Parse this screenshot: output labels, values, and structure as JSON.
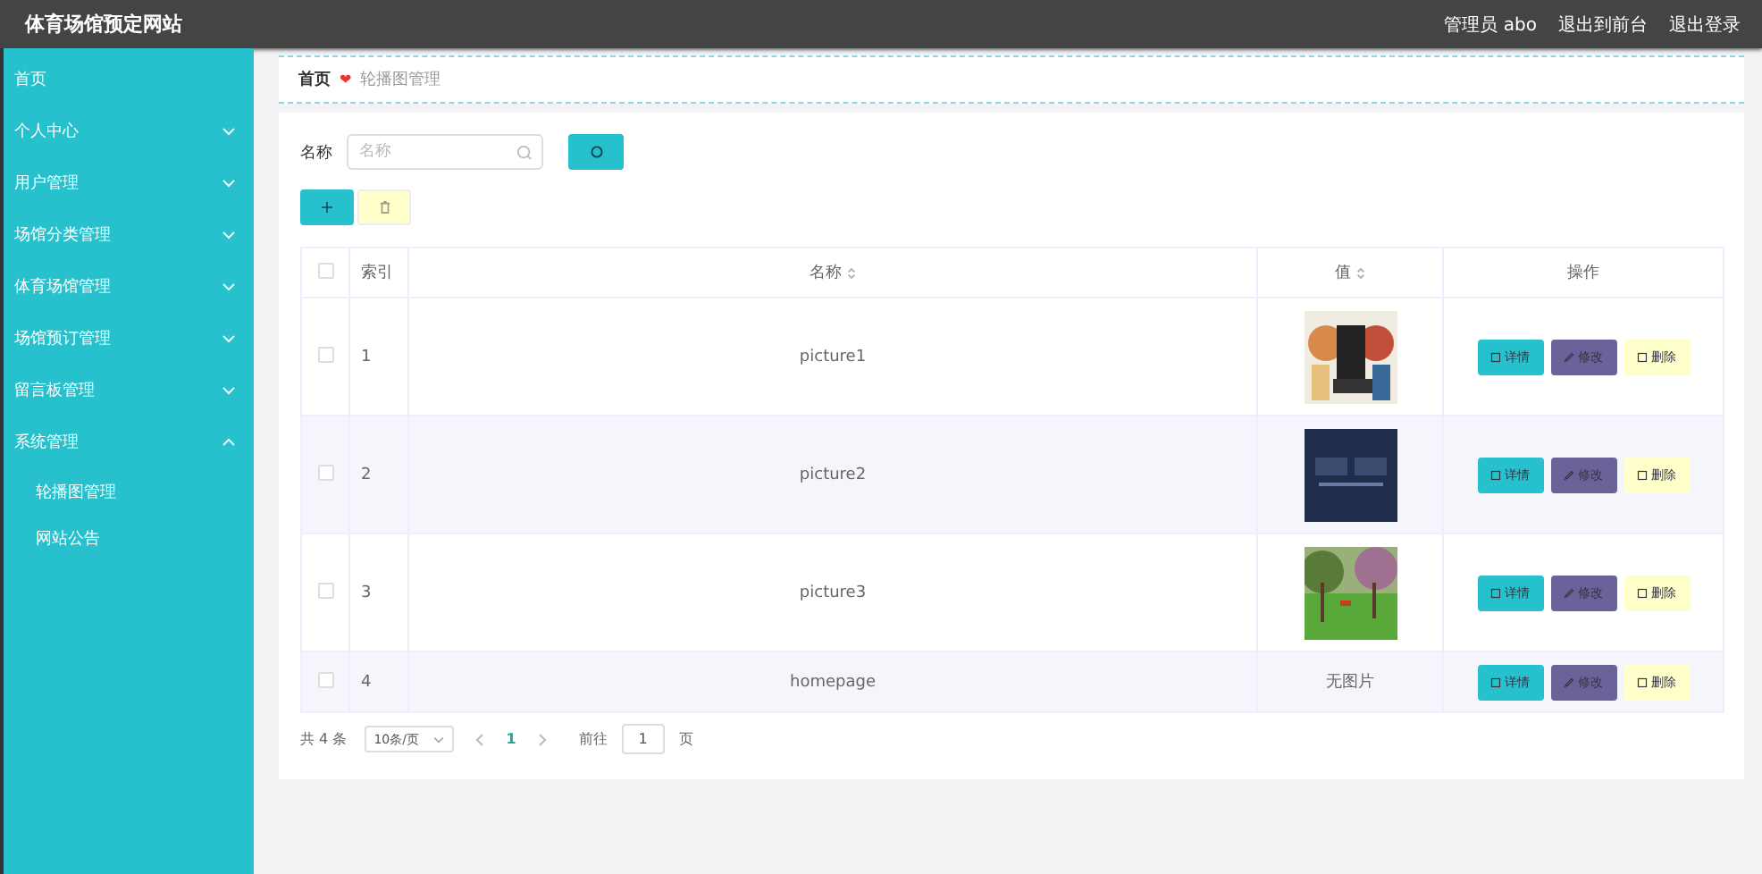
{
  "header": {
    "title": "体育场馆预定网站",
    "links": [
      "管理员 abo",
      "退出到前台",
      "退出登录"
    ]
  },
  "sidebar": {
    "items": [
      {
        "label": "首页"
      },
      {
        "label": "个人中心",
        "expanded": false
      },
      {
        "label": "用户管理",
        "expanded": false
      },
      {
        "label": "场馆分类管理",
        "expanded": false
      },
      {
        "label": "体育场馆管理",
        "expanded": false
      },
      {
        "label": "场馆预订管理",
        "expanded": false
      },
      {
        "label": "留言板管理",
        "expanded": false
      },
      {
        "label": "系统管理",
        "expanded": true,
        "children": [
          {
            "label": "轮播图管理"
          },
          {
            "label": "网站公告"
          }
        ]
      }
    ]
  },
  "breadcrumb": {
    "items": [
      "首页",
      "轮播图管理"
    ],
    "separator": "❤"
  },
  "search": {
    "label": "名称",
    "placeholder": "名称"
  },
  "table": {
    "columns": [
      "索引",
      "名称",
      "值",
      "操作"
    ],
    "rows": [
      {
        "checked": false,
        "index": "1",
        "name": "picture1",
        "value": {
          "kind": "picture"
        },
        "actions": [
          "详情",
          "修改",
          "删除"
        ]
      },
      {
        "checked": false,
        "index": "2",
        "name": "picture2",
        "value": {
          "kind": "picture"
        },
        "actions": [
          "详情",
          "修改",
          "删除"
        ]
      },
      {
        "checked": false,
        "index": "3",
        "name": "picture3",
        "value": {
          "kind": "picture"
        },
        "actions": [
          "详情",
          "修改",
          "删除"
        ]
      },
      {
        "checked": false,
        "index": "4",
        "name": "homepage",
        "value": {
          "kind": "text",
          "text": "无图片"
        },
        "actions": [
          "详情",
          "修改",
          "删除"
        ]
      }
    ],
    "all_checked": false
  },
  "pagination": {
    "total": "共 4 条",
    "page_size": "10条/页",
    "current": "1",
    "goto_label": "前往",
    "goto_value": "1",
    "goto_suffix": "页"
  }
}
